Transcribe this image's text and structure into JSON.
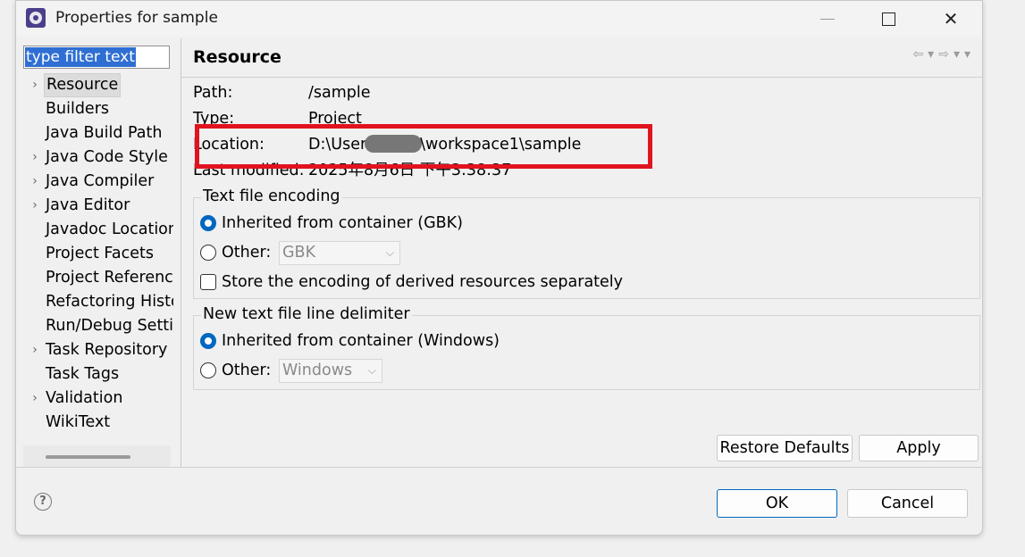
{
  "window": {
    "title": "Properties for sample",
    "minimize_glyph": "—",
    "close_glyph": "✕"
  },
  "filter": {
    "text": "type filter text"
  },
  "tree": {
    "items": [
      {
        "label": "Resource",
        "expandable": true,
        "selected": true
      },
      {
        "label": "Builders",
        "expandable": false
      },
      {
        "label": "Java Build Path",
        "expandable": false
      },
      {
        "label": "Java Code Style",
        "expandable": true
      },
      {
        "label": "Java Compiler",
        "expandable": true
      },
      {
        "label": "Java Editor",
        "expandable": true
      },
      {
        "label": "Javadoc Location",
        "expandable": false
      },
      {
        "label": "Project Facets",
        "expandable": false
      },
      {
        "label": "Project References",
        "expandable": false
      },
      {
        "label": "Refactoring History",
        "expandable": false
      },
      {
        "label": "Run/Debug Settings",
        "expandable": false
      },
      {
        "label": "Task Repository",
        "expandable": true
      },
      {
        "label": "Task Tags",
        "expandable": false
      },
      {
        "label": "Validation",
        "expandable": true
      },
      {
        "label": "WikiText",
        "expandable": false
      }
    ],
    "expand_glyph": "›"
  },
  "page": {
    "title": "Resource",
    "nav_glyphs": "⇦▾⇨▾▾",
    "path_label": "Path:",
    "path_value": "/sample",
    "type_label": "Type:",
    "type_value": "Project",
    "location_label": "Location:",
    "location_prefix": "D:\\User",
    "location_suffix": "\\workspace1\\sample",
    "modified_label": "Last modified:",
    "modified_value": "2025年8月6日 下午3:38:37"
  },
  "encoding": {
    "legend": "Text file encoding",
    "inherited_label": "Inherited from container (GBK)",
    "other_label": "Other:",
    "other_value": "GBK",
    "store_label": "Store the encoding of derived resources separately",
    "selected": "inherited"
  },
  "delimiter": {
    "legend": "New text file line delimiter",
    "inherited_label": "Inherited from container (Windows)",
    "other_label": "Other:",
    "other_value": "Windows",
    "selected": "inherited"
  },
  "buttons": {
    "restore_defaults": "Restore Defaults",
    "apply": "Apply",
    "ok": "OK",
    "cancel": "Cancel",
    "help_glyph": "?"
  },
  "colors": {
    "accent": "#0067c0",
    "filter_selection": "#2f6fd3",
    "highlight_box": "#e0141e"
  }
}
